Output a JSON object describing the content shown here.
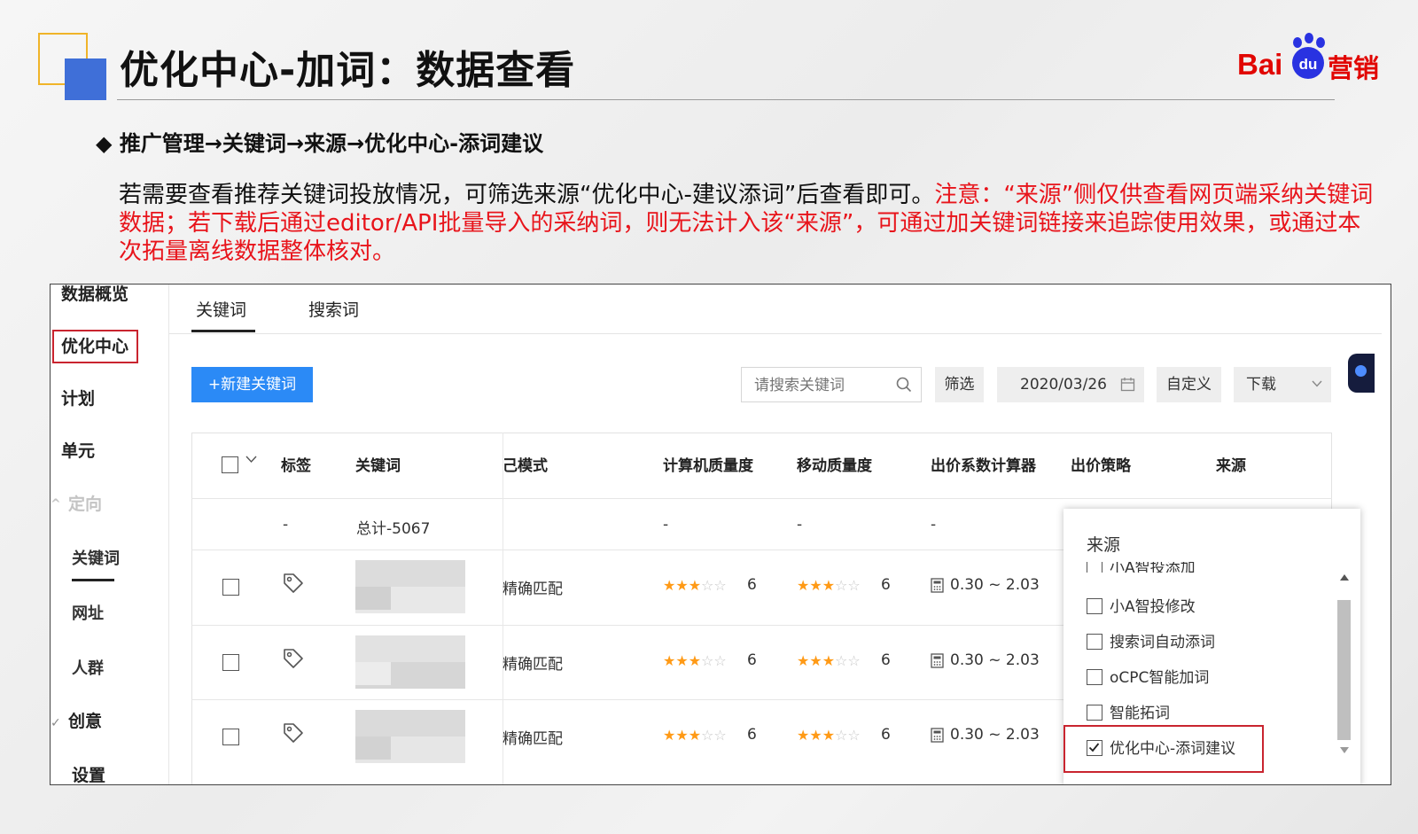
{
  "slide": {
    "title": "优化中心-加词：数据查看",
    "bullet": "◆ 推广管理→关键词→来源→优化中心-添词建议",
    "desc_black": "若需要查看推荐关键词投放情况，可筛选来源“优化中心-建议添词”后查看即可。",
    "desc_red": "注意：“来源”侧仅供查看网页端采纳关键词数据；若下载后通过editor/API批量导入的采纳词，则无法计入该“来源”，可通过加关键词链接来追踪使用效果，或通过本次拓量离线数据整体核对。",
    "logo": {
      "bai": "Bai",
      "du": "du",
      "yx": "营销"
    }
  },
  "colors": {
    "accent_red": "#e8141b",
    "primary_blue": "#2b8af6",
    "star": "#ff9a16",
    "highlight_border": "#c9242f"
  },
  "nav": {
    "items": [
      "数据概览",
      "优化中心",
      "计划",
      "单元",
      "定向",
      "关键词",
      "网址",
      "人群",
      "创意",
      "设置"
    ],
    "active": "优化中心",
    "collapse_marks": [
      "^",
      "✓"
    ]
  },
  "tabs": [
    "关键词",
    "搜索词"
  ],
  "toolbar": {
    "new_button": "+新建关键词",
    "search_placeholder": "请搜索关键词",
    "filter": "筛选",
    "date": "2020/03/26",
    "custom": "自定义",
    "download": "下载"
  },
  "table": {
    "headers": [
      "标签",
      "关键词",
      "己模式",
      "计算机质量度",
      "移动质量度",
      "出价系数计算器",
      "出价策略",
      "来源"
    ],
    "total": {
      "tag": "-",
      "keyword": "总计-5067",
      "pc_quality": "-",
      "mobile_quality": "-",
      "bid_calc": "-"
    },
    "rows": [
      {
        "match": "精确匹配",
        "pc_stars": 3,
        "pc_score": "6",
        "mobile_stars": 3,
        "mobile_score": "6",
        "bid_range": "0.30 ~ 2.03"
      },
      {
        "match": "精确匹配",
        "pc_stars": 3,
        "pc_score": "6",
        "mobile_stars": 3,
        "mobile_score": "6",
        "bid_range": "0.30 ~ 2.03"
      },
      {
        "match": "精确匹配",
        "pc_stars": 3,
        "pc_score": "6",
        "mobile_stars": 3,
        "mobile_score": "6",
        "bid_range": "0.30 ~ 2.03"
      }
    ],
    "max_stars": 5
  },
  "source_filter": {
    "title": "来源",
    "clipped_option": "小A智投添加",
    "options": [
      {
        "label": "小A智投修改",
        "checked": false
      },
      {
        "label": "搜索词自动添词",
        "checked": false
      },
      {
        "label": "oCPC智能加词",
        "checked": false
      },
      {
        "label": "智能拓词",
        "checked": false
      },
      {
        "label": "优化中心-添词建议",
        "checked": true
      }
    ]
  },
  "icons": [
    "search-icon",
    "calendar-icon",
    "chevron-down-icon",
    "tag-icon",
    "calculator-icon",
    "star-icon",
    "scroll-up-icon",
    "scroll-down-icon"
  ]
}
